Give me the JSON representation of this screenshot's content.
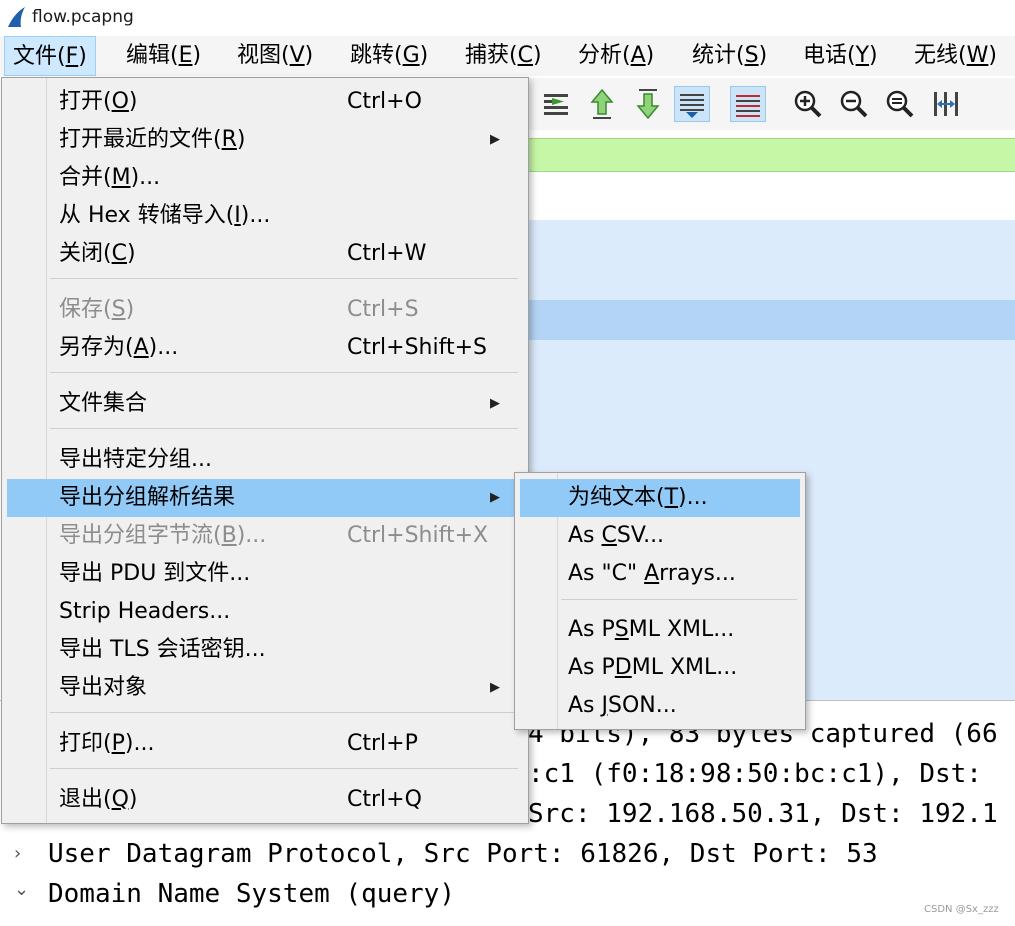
{
  "window": {
    "title": "flow.pcapng"
  },
  "menubar": [
    {
      "label": "文件(",
      "mn": "F",
      "tail": ")"
    },
    {
      "label": "编辑(",
      "mn": "E",
      "tail": ")"
    },
    {
      "label": "视图(",
      "mn": "V",
      "tail": ")"
    },
    {
      "label": "跳转(",
      "mn": "G",
      "tail": ")"
    },
    {
      "label": "捕获(",
      "mn": "C",
      "tail": ")"
    },
    {
      "label": "分析(",
      "mn": "A",
      "tail": ")"
    },
    {
      "label": "统计(",
      "mn": "S",
      "tail": ")"
    },
    {
      "label": "电话(",
      "mn": "Y",
      "tail": ")"
    },
    {
      "label": "无线(",
      "mn": "W",
      "tail": ")"
    }
  ],
  "toolbar": [
    "go-to-packet-icon",
    "previous-packet-icon",
    "next-packet-icon",
    "auto-scroll-icon",
    "colorize-icon",
    "zoom-in-icon",
    "zoom-out-icon",
    "normal-size-icon",
    "resize-columns-icon"
  ],
  "file_menu": {
    "open": {
      "pre": "打开(",
      "mn": "O",
      "post": ")",
      "shortcut": "Ctrl+O"
    },
    "open_recent": {
      "pre": "打开最近的文件(",
      "mn": "R",
      "post": ")"
    },
    "merge": {
      "pre": "合并(",
      "mn": "M",
      "post": ")..."
    },
    "import_hex": {
      "pre": "从 Hex 转储导入(",
      "mn": "I",
      "post": ")..."
    },
    "close": {
      "pre": "关闭(",
      "mn": "C",
      "post": ")",
      "shortcut": "Ctrl+W"
    },
    "save": {
      "pre": "保存(",
      "mn": "S",
      "post": ")",
      "shortcut": "Ctrl+S"
    },
    "save_as": {
      "pre": "另存为(",
      "mn": "A",
      "post": ")...",
      "shortcut": "Ctrl+Shift+S"
    },
    "file_set": {
      "label": "文件集合"
    },
    "export_specified": {
      "label": "导出特定分组..."
    },
    "export_dissections": {
      "label": "导出分组解析结果"
    },
    "export_bytes": {
      "pre": "导出分组字节流(",
      "mn": "B",
      "post": ")...",
      "shortcut": "Ctrl+Shift+X"
    },
    "export_pdu": {
      "label": "导出 PDU 到文件..."
    },
    "strip_headers": {
      "label": "Strip Headers..."
    },
    "export_tls": {
      "label": "导出 TLS 会话密钥..."
    },
    "export_objects": {
      "label": "导出对象"
    },
    "print": {
      "pre": "打印(",
      "mn": "P",
      "post": ")...",
      "shortcut": "Ctrl+P"
    },
    "quit": {
      "pre": "退出(",
      "mn": "Q",
      "post": ")",
      "shortcut": "Ctrl+Q"
    }
  },
  "export_submenu": {
    "plain_text": {
      "pre": "为纯文本(",
      "mn": "T",
      "post": ")..."
    },
    "csv": {
      "pre": "As ",
      "mn": "C",
      "post": "SV..."
    },
    "c_arrays": {
      "pre": "As \"C\" ",
      "mn": "A",
      "post": "rrays..."
    },
    "psml": {
      "pre": "As P",
      "mn": "S",
      "post": "ML XML..."
    },
    "pdml": {
      "pre": "As P",
      "mn": "D",
      "post": "ML XML..."
    },
    "json": {
      "pre": "As ",
      "mn": "J",
      "post": "SON..."
    }
  },
  "details": {
    "line1": "4 bits), 83 bytes captured (66",
    "line2": ":c1 (f0:18:98:50:bc:c1), Dst: ",
    "line3": "Src: 192.168.50.31, Dst: 192.1",
    "line4": "User Datagram Protocol, Src Port: 61826, Dst Port: 53",
    "line5": "Domain Name System (query)",
    "chev_collapsed": "›",
    "chev_expanded": "⌄"
  },
  "watermark": "CSDN @Sx_zzz"
}
